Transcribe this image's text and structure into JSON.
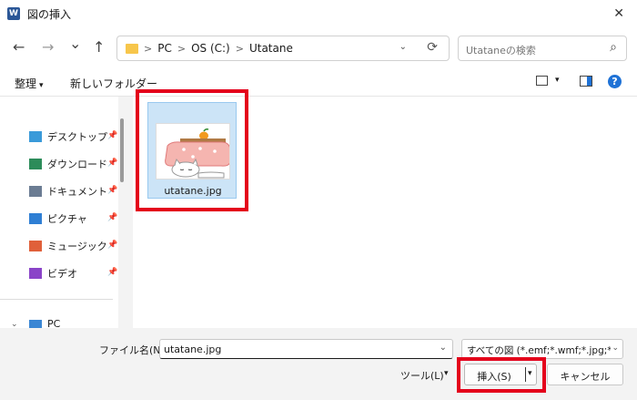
{
  "window": {
    "title": "図の挿入",
    "app_icon_letter": "W",
    "close_glyph": "✕"
  },
  "nav": {
    "back_glyph": "←",
    "forward_glyph": "→",
    "recent_glyph": "⌄",
    "up_glyph": "↑",
    "breadcrumb": [
      "PC",
      "OS (C:)",
      "Utatane"
    ],
    "breadcrumb_sep": ">",
    "dropdown_glyph": "⌄",
    "refresh_glyph": "⟳",
    "search_placeholder": "Utataneの検索",
    "search_glyph": "⌕"
  },
  "commands": {
    "organize": "整理",
    "organize_caret": "▾",
    "new_folder": "新しいフォルダー",
    "view_caret": "▾",
    "help_glyph": "?"
  },
  "sidebar": {
    "items": [
      {
        "label": "デスクトップ",
        "icon": "desktop-icon",
        "color": "#3a9ad9"
      },
      {
        "label": "ダウンロード",
        "icon": "download-icon",
        "color": "#2d8c5a"
      },
      {
        "label": "ドキュメント",
        "icon": "document-icon",
        "color": "#6b7c93"
      },
      {
        "label": "ピクチャ",
        "icon": "pictures-icon",
        "color": "#2f7fd4"
      },
      {
        "label": "ミュージック",
        "icon": "music-icon",
        "color": "#e0603a"
      },
      {
        "label": "ビデオ",
        "icon": "video-icon",
        "color": "#8a44c8"
      }
    ],
    "pin_glyph": "📌",
    "pc_label": "PC",
    "pc_caret": "⌄"
  },
  "files": [
    {
      "name": "utatane.jpg",
      "selected": true
    }
  ],
  "footer": {
    "filename_label": "ファイル名(N):",
    "filename_value": "utatane.jpg",
    "filename_dd": "⌄",
    "filetype_value": "すべての図 (*.emf;*.wmf;*.jpg;*.jp",
    "filetype_dd": "⌄",
    "tools_label": "ツール(L)",
    "tools_caret": "▾",
    "insert_label": "挿入(S)",
    "insert_caret": "▾",
    "cancel_label": "キャンセル"
  },
  "colors": {
    "highlight": "#e4001b",
    "selection": "#cce4f7",
    "accent": "#1f72d6"
  }
}
